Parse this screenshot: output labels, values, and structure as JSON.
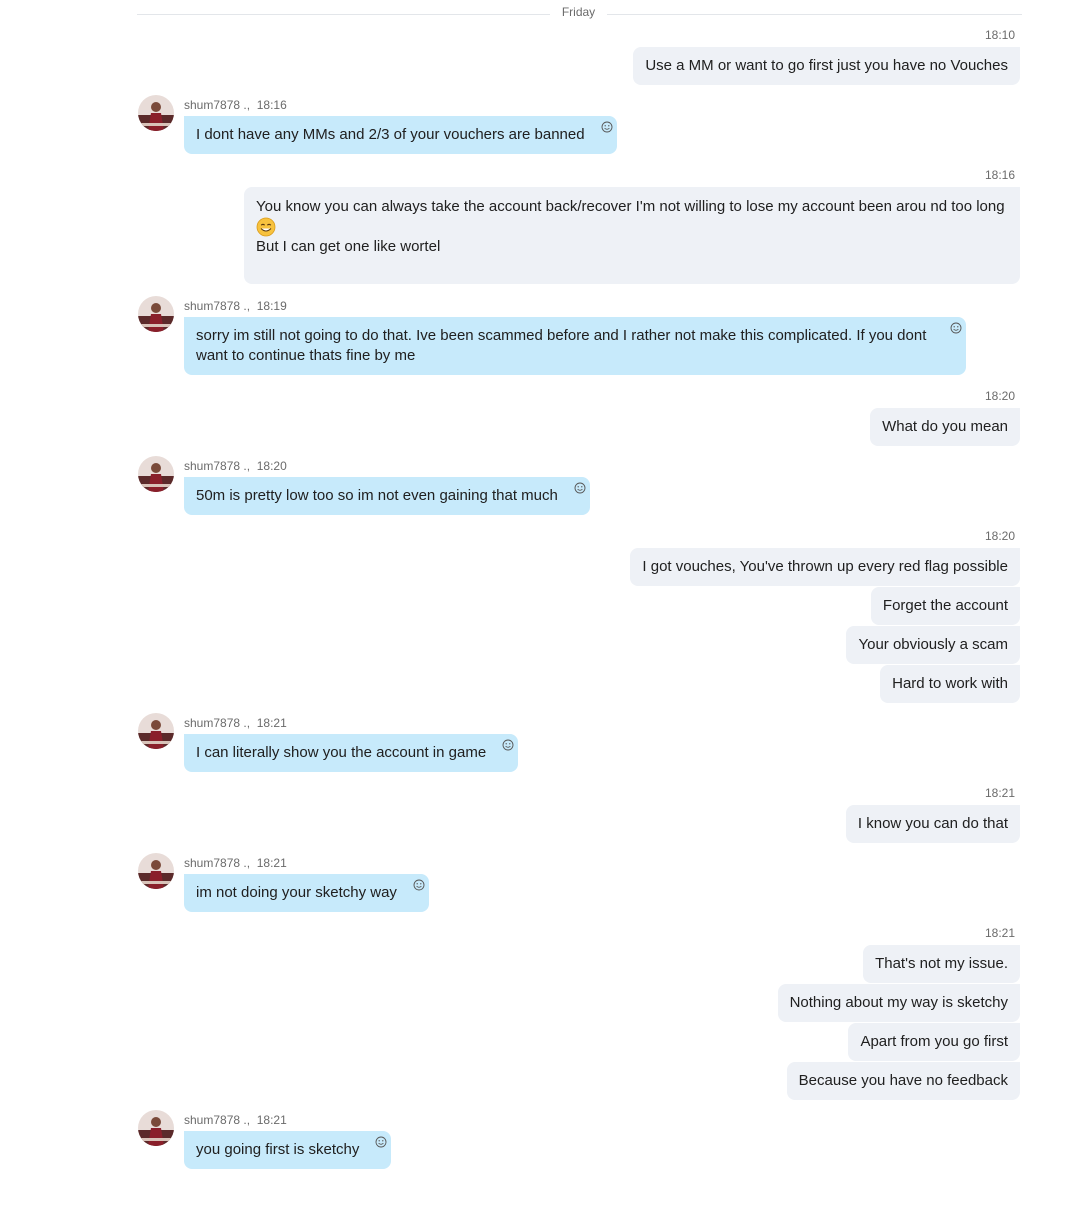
{
  "day_separator": "Friday",
  "contact": {
    "name": "shum7878 .,"
  },
  "colors": {
    "outgoing_bubble": "#eef1f6",
    "incoming_bubble": "#c7eafb"
  },
  "messages": [
    {
      "dir": "out",
      "time": "18:10",
      "lines": [
        "Use a MM or want to go first just you have no Vouches"
      ]
    },
    {
      "dir": "in",
      "time": "18:16",
      "lines": [
        "I dont have any MMs and 2/3 of your vouchers are banned"
      ]
    },
    {
      "dir": "out",
      "time": "18:16",
      "lines": [
        "You know you can always take the account back/recover I'm not willing to lose my account been arou nd too long",
        "But I can get one like wortel"
      ],
      "emoji": "smiling-face-icon"
    },
    {
      "dir": "in",
      "time": "18:19",
      "lines": [
        "sorry im still not going to do that. Ive been scammed before and I rather not make this complicated. If you dont",
        "want to continue thats fine by me"
      ]
    },
    {
      "dir": "out",
      "time": "18:20",
      "lines": [
        "What do you mean"
      ]
    },
    {
      "dir": "in",
      "time": "18:20",
      "lines": [
        "50m is pretty low too so im not even gaining that much"
      ]
    },
    {
      "dir": "out",
      "time": "18:20",
      "lines": [
        "I got vouches, You've thrown up every red flag possible"
      ]
    },
    {
      "dir": "out",
      "lines": [
        "Forget the account"
      ]
    },
    {
      "dir": "out",
      "lines": [
        "Your obviously a scam"
      ]
    },
    {
      "dir": "out",
      "lines": [
        "Hard to work with"
      ]
    },
    {
      "dir": "in",
      "time": "18:21",
      "lines": [
        "I can literally show you the account in game"
      ]
    },
    {
      "dir": "out",
      "time": "18:21",
      "lines": [
        "I know you can do that"
      ]
    },
    {
      "dir": "in",
      "time": "18:21",
      "lines": [
        "im not doing your sketchy way"
      ]
    },
    {
      "dir": "out",
      "time": "18:21",
      "lines": [
        "That's not my issue."
      ]
    },
    {
      "dir": "out",
      "lines": [
        "Nothing about my way is sketchy"
      ]
    },
    {
      "dir": "out",
      "lines": [
        "Apart from you go first"
      ]
    },
    {
      "dir": "out",
      "lines": [
        "Because you  have no feedback"
      ]
    },
    {
      "dir": "in",
      "time": "18:21",
      "lines": [
        "you going first is sketchy"
      ]
    }
  ]
}
